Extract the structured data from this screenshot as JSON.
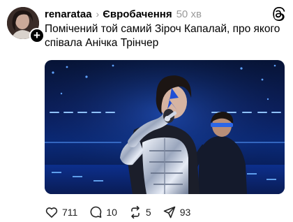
{
  "post": {
    "username": "renarataa",
    "separator": "›",
    "topic": "Євробачення",
    "time": "50 хв",
    "text": "Помічений той самий Зіроч Капалай, про якого співала Анічка Трінчер"
  },
  "actions": {
    "likes": "711",
    "comments": "10",
    "reposts": "5",
    "shares": "93"
  },
  "icons": {
    "follow": "plus-icon",
    "app": "threads-logo-icon",
    "like": "heart-icon",
    "comment": "comment-bubble-icon",
    "repost": "repost-arrows-icon",
    "share": "send-icon"
  }
}
